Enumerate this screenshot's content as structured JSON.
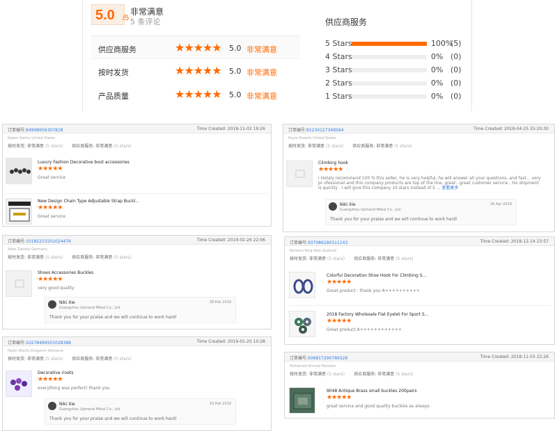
{
  "summary": {
    "score": "5.0",
    "score_den": "/5",
    "satisfaction": "非常满意",
    "review_count": "5 条评论",
    "ratings": [
      {
        "label": "供应商服务",
        "value": "5.0",
        "verdict": "非常满意",
        "stars": "★★★★★"
      },
      {
        "label": "按时发货",
        "value": "5.0",
        "verdict": "非常满意",
        "stars": "★★★★★"
      },
      {
        "label": "产品质量",
        "value": "5.0",
        "verdict": "非常满意",
        "stars": "★★★★★"
      }
    ],
    "breakdown_title": "供应商服务",
    "breakdown": [
      {
        "label": "5 Stars",
        "pct": "100%",
        "count": "(5)",
        "fill": 1.0
      },
      {
        "label": "4 Stars",
        "pct": "0%",
        "count": "(0)",
        "fill": 0
      },
      {
        "label": "3 Stars",
        "pct": "0%",
        "count": "(0)",
        "fill": 0
      },
      {
        "label": "2 Stars",
        "pct": "0%",
        "count": "(0)",
        "fill": 0
      },
      {
        "label": "1 Stars",
        "pct": "0%",
        "count": "(0)",
        "fill": 0
      }
    ],
    "accent": "#ff6a00"
  },
  "labels": {
    "order_label": "订单编号:",
    "time_prefix": "Time Created: ",
    "ontime": "按时发货:",
    "supplier": "供应商服务:",
    "very_sat": "非常满意",
    "stars_note": "(5 stars)",
    "stars": "★★★★★"
  },
  "cards": [
    {
      "order_id": "94908656307818",
      "time": "2018-11-02 19:26",
      "buyer": "Kwaro Salmu United States",
      "items": [
        {
          "name": "Luxury Fashion Decorative boot accessories",
          "comment": "Great service"
        },
        {
          "name": "New Design Chain Type Adjustable Strap Buckl...",
          "comment": "Great service"
        }
      ]
    },
    {
      "order_id": "91230127349564",
      "time": "2018-04-25 25:20:30",
      "buyer": "Paula Poweliz United States",
      "items": [
        {
          "name": "Climbing hook",
          "comment": "i Hotaly recommend 100 % this seller, he is very helpful, he will answer all your questions, and fast... very pr ofessional and this company products are top of the line, great...great customer service , his shipment is quickly . I will give this company 10 stars instead of 5 ...",
          "more": "查看更多"
        }
      ],
      "reply": {
        "name": "Niki Xie",
        "company": "Guangzhou Upmend Metal Co., Ltd.",
        "date": "26 Apr 2018",
        "text": "Thank you for your praise and we will continue to work hard!"
      }
    },
    {
      "order_id": "10185215501024476",
      "time": "2019-02-26 22:06",
      "buyer": "Allen Zievest Germany",
      "items": [
        {
          "name": "Shoes Accessories Buckles",
          "comment": "very good quality"
        }
      ],
      "reply": {
        "name": "Niki Xie",
        "company": "Guangzhou Upmend Metal Co., Ltd.",
        "date": "28 Feb 2019",
        "text": "Thank you for your praise and we will continue to work hard!"
      }
    },
    {
      "order_id": "507086180311143",
      "time": "2018-12-14 23:57",
      "buyer": "Barbara King New Zealand",
      "items": [
        {
          "name": "Colorful Decoration Shoe Hook For Climbing S...",
          "comment": "Great product - thank you A++++++++++"
        },
        {
          "name": "2018 Factory Wholesale Flat Eyelet For Sport S...",
          "comment": "Great product A++++++++++++"
        }
      ]
    },
    {
      "order_id": "10278499501028388",
      "time": "2019-01-20 10:28",
      "buyer": "Paolo Vitoriu Dragomir Romania",
      "items": [
        {
          "name": "Decorative rivets",
          "comment": "everything was perfect! thank you"
        }
      ],
      "reply": {
        "name": "Niki Xie",
        "company": "Guangzhou Upmend Metal Co., Ltd.",
        "date": "19 Feb 2019",
        "text": "Thank you for your praise and we will continue to work hard!"
      }
    },
    {
      "order_id": "506817290789329",
      "time": "2018-11-03 22:26",
      "buyer": "Mohamad Ahmad Pakistan",
      "items": [
        {
          "name": "9048 Antique Brass small buckles 200pairs",
          "comment": "great service and good quality buckles as always"
        }
      ]
    }
  ]
}
